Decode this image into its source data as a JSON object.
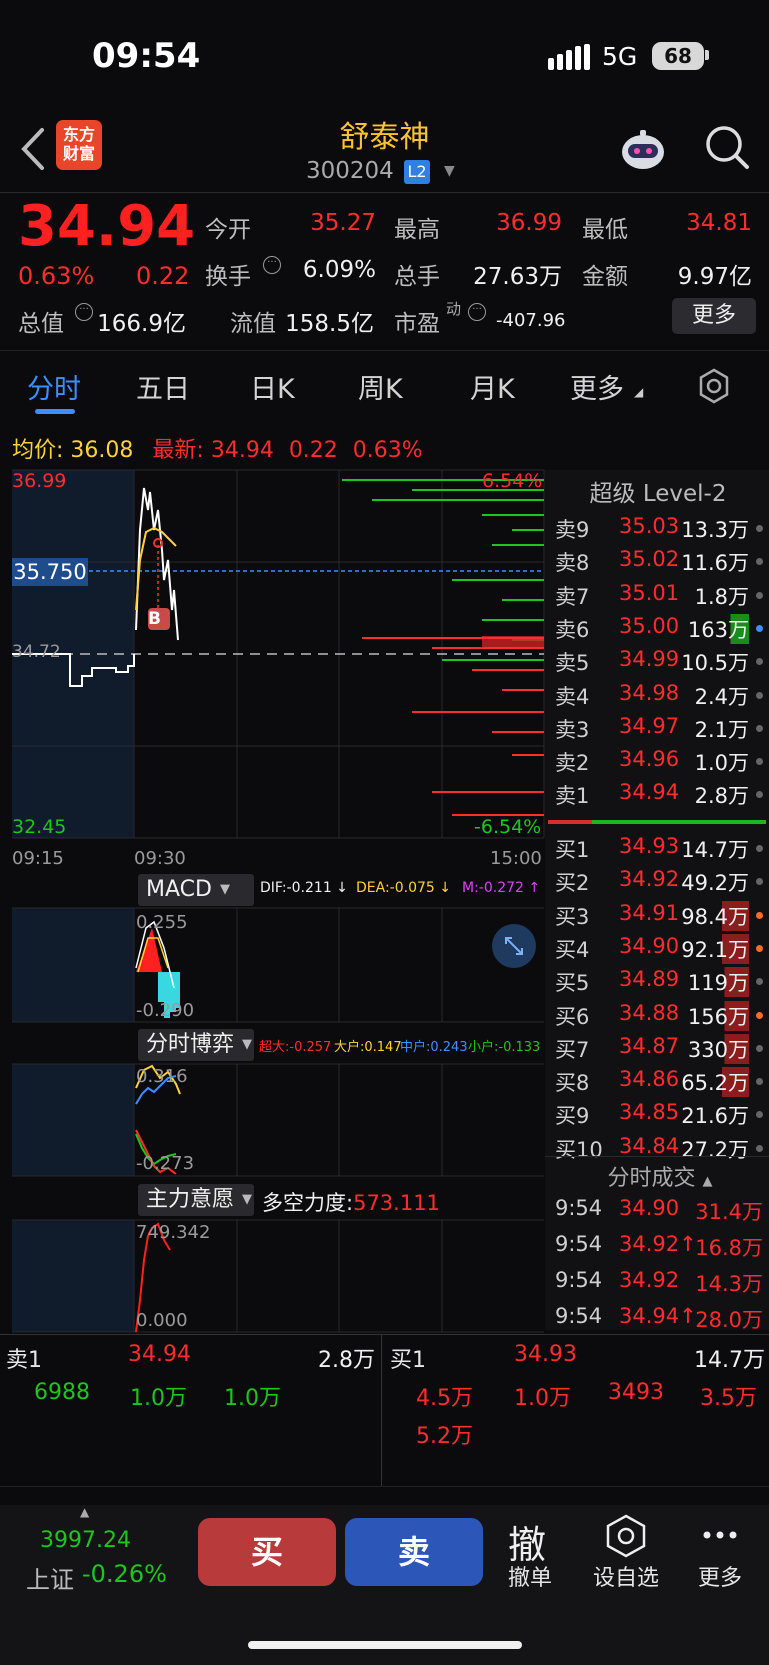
{
  "status": {
    "time": "09:54",
    "network": "5G",
    "battery": "68"
  },
  "header": {
    "logo": [
      "东方",
      "财富"
    ],
    "name": "舒泰神",
    "code": "300204",
    "badge": "L2"
  },
  "quote": {
    "price": "34.94",
    "pct": "0.63%",
    "change": "0.22",
    "open_label": "今开",
    "open": "35.27",
    "high_label": "最高",
    "high": "36.99",
    "low_label": "最低",
    "low": "34.81",
    "turnover_label": "换手",
    "turnover": "6.09%",
    "volume_label": "总手",
    "volume": "27.63万",
    "amount_label": "金额",
    "amount": "9.97亿",
    "mktcap_label": "总值",
    "mktcap": "166.9亿",
    "float_label": "流值",
    "float": "158.5亿",
    "pe_label": "市盈",
    "pe_sup": "动",
    "pe": "-407.96",
    "more": "更多"
  },
  "tabs": [
    "分时",
    "五日",
    "日K",
    "周K",
    "月K",
    "更多"
  ],
  "avg_row": {
    "avg_label": "均价:",
    "avg": "36.08",
    "last_label": "最新:",
    "last": "34.94",
    "chg": "0.22",
    "pct": "0.63%"
  },
  "chart": {
    "y_top": "36.99",
    "y_bottom": "32.45",
    "pct_top": "6.54%",
    "pct_bottom": "-6.54%",
    "prev_close": "34.72",
    "cursor_price": "35.750",
    "marker": "B",
    "t_start": "09:15",
    "t_mid": "09:30",
    "t_end": "15:00"
  },
  "macd": {
    "name": "MACD",
    "dif": "DIF:-0.211 ↓",
    "dea": "DEA:-0.075 ↓",
    "m": "M:-0.272 ↑",
    "top": "0.255",
    "bottom": "-0.290"
  },
  "game": {
    "name": "分时博弈",
    "super": "超大:-0.257",
    "large": "大户:0.147",
    "mid": "中户:0.243",
    "small": "小户:-0.133",
    "top": "0.316",
    "bottom": "-0.273"
  },
  "will": {
    "name": "主力意愿",
    "label": "多空力度:",
    "value": "573.111",
    "top": "749.342",
    "bottom": "0.000"
  },
  "orderbook": {
    "title": "超级 Level-2",
    "asks": [
      {
        "label": "卖9",
        "price": "35.03",
        "vol": "13.3万"
      },
      {
        "label": "卖8",
        "price": "35.02",
        "vol": "11.6万"
      },
      {
        "label": "卖7",
        "price": "35.01",
        "vol": "1.8万"
      },
      {
        "label": "卖6",
        "price": "35.00",
        "vol": "163万"
      },
      {
        "label": "卖5",
        "price": "34.99",
        "vol": "10.5万"
      },
      {
        "label": "卖4",
        "price": "34.98",
        "vol": "2.4万"
      },
      {
        "label": "卖3",
        "price": "34.97",
        "vol": "2.1万"
      },
      {
        "label": "卖2",
        "price": "34.96",
        "vol": "1.0万"
      },
      {
        "label": "卖1",
        "price": "34.94",
        "vol": "2.8万"
      }
    ],
    "bids": [
      {
        "label": "买1",
        "price": "34.93",
        "vol": "14.7万"
      },
      {
        "label": "买2",
        "price": "34.92",
        "vol": "49.2万"
      },
      {
        "label": "买3",
        "price": "34.91",
        "vol": "98.4万"
      },
      {
        "label": "买4",
        "price": "34.90",
        "vol": "92.1万"
      },
      {
        "label": "买5",
        "price": "34.89",
        "vol": "119万"
      },
      {
        "label": "买6",
        "price": "34.88",
        "vol": "156万"
      },
      {
        "label": "买7",
        "price": "34.87",
        "vol": "330万"
      },
      {
        "label": "买8",
        "price": "34.86",
        "vol": "65.2万"
      },
      {
        "label": "买9",
        "price": "34.85",
        "vol": "21.6万"
      },
      {
        "label": "买10",
        "price": "34.84",
        "vol": "27.2万"
      }
    ]
  },
  "ticks": {
    "title": "分时成交",
    "rows": [
      {
        "time": "9:54",
        "price": "34.90",
        "vol": "31.4万"
      },
      {
        "time": "9:54",
        "price": "34.92↑",
        "vol": "16.8万"
      },
      {
        "time": "9:54",
        "price": "34.92",
        "vol": "14.3万"
      },
      {
        "time": "9:54",
        "price": "34.94↑",
        "vol": "28.0万"
      }
    ]
  },
  "queue": {
    "ask_label": "卖1",
    "ask_price": "34.94",
    "ask_vol": "2.8万",
    "ask_items": [
      "6988",
      "1.0万",
      "1.0万"
    ],
    "bid_label": "买1",
    "bid_price": "34.93",
    "bid_vol": "14.7万",
    "bid_items": [
      "4.5万",
      "1.0万",
      "3493",
      "3.5万",
      "5.2万"
    ]
  },
  "bottom": {
    "index_value": "3997.24",
    "index_name": "上证",
    "index_pct": "-0.26%",
    "buy": "买",
    "sell": "卖",
    "cancel_glyph": "撤",
    "cancel": "撤单",
    "watch": "设自选",
    "more": "更多"
  },
  "colors": {
    "up": "#ff2d2d",
    "down": "#1fc41f",
    "accent": "#3d8fff",
    "avg_line": "#ffd23a"
  }
}
